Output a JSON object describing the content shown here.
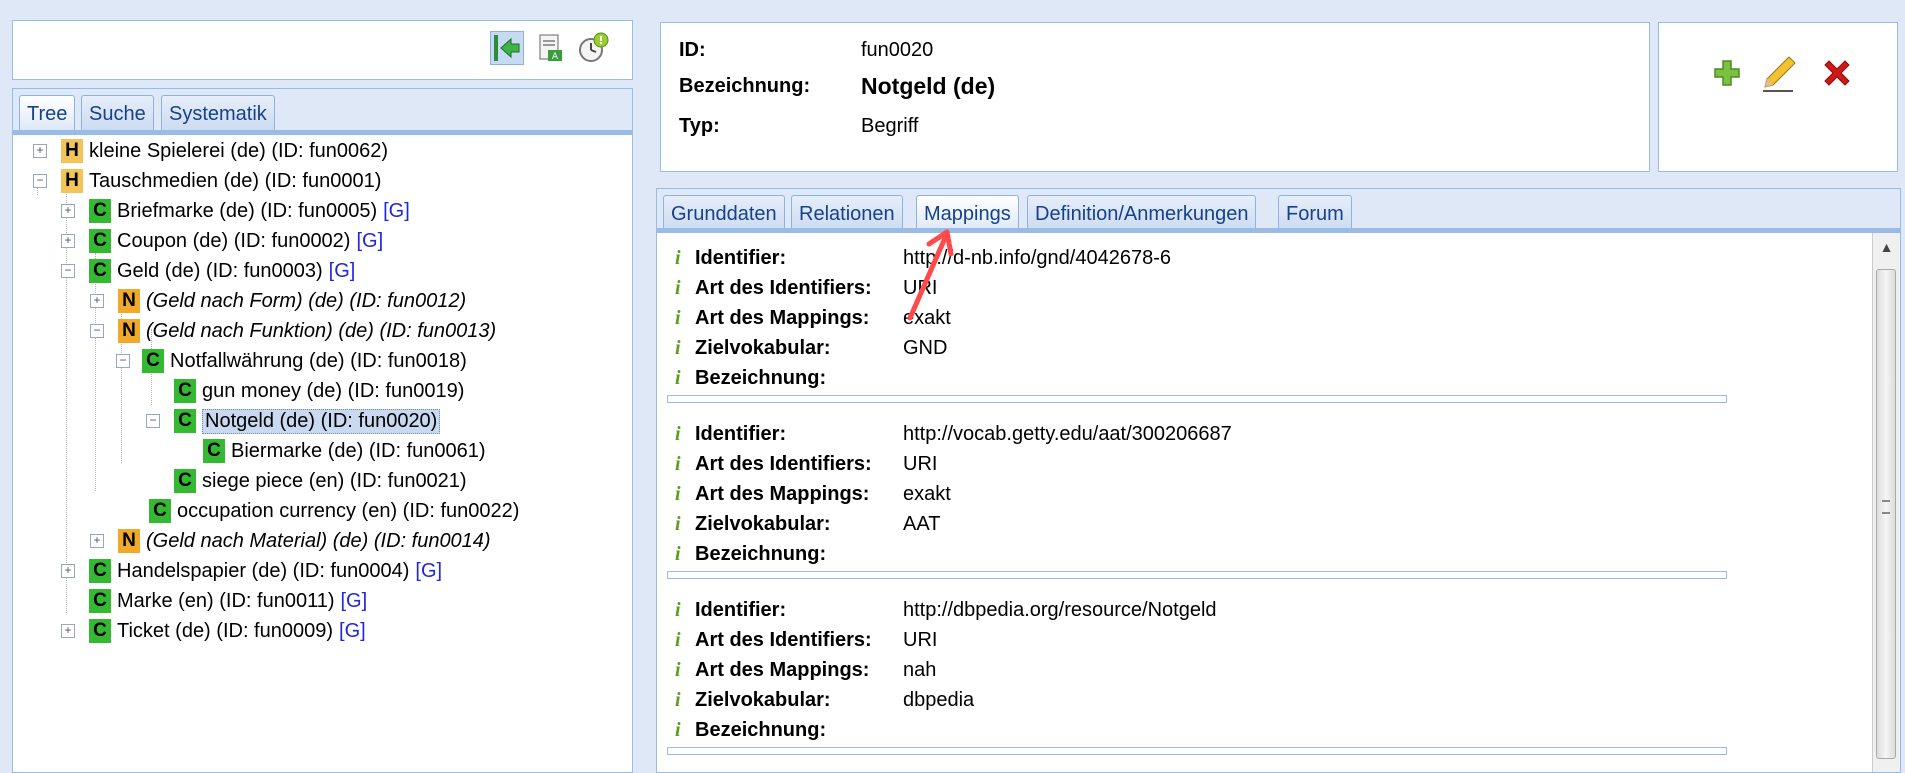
{
  "left_tabs": [
    "Tree",
    "Suche",
    "Systematik"
  ],
  "tree": [
    {
      "badge": "H",
      "label": "kleine Spielerei (de) (ID: fun0062)",
      "italic": false,
      "g": ""
    },
    {
      "badge": "H",
      "label": "Tauschmedien (de) (ID: fun0001)",
      "italic": false,
      "g": ""
    },
    {
      "badge": "C",
      "label": "Briefmarke (de) (ID: fun0005)",
      "italic": false,
      "g": "[G]"
    },
    {
      "badge": "C",
      "label": "Coupon (de) (ID: fun0002)",
      "italic": false,
      "g": "[G]"
    },
    {
      "badge": "C",
      "label": "Geld (de) (ID: fun0003)",
      "italic": false,
      "g": "[G]"
    },
    {
      "badge": "N",
      "label": "(Geld nach Form) (de) (ID: fun0012)",
      "italic": true,
      "g": ""
    },
    {
      "badge": "N",
      "label": "(Geld nach Funktion) (de) (ID: fun0013)",
      "italic": true,
      "g": ""
    },
    {
      "badge": "C",
      "label": "Notfallwährung (de) (ID: fun0018)",
      "italic": false,
      "g": ""
    },
    {
      "badge": "C",
      "label": "gun money (de) (ID: fun0019)",
      "italic": false,
      "g": ""
    },
    {
      "badge": "C",
      "label": "Notgeld (de) (ID: fun0020)",
      "italic": false,
      "g": ""
    },
    {
      "badge": "C",
      "label": "Biermarke (de) (ID: fun0061)",
      "italic": false,
      "g": ""
    },
    {
      "badge": "C",
      "label": "siege piece (en) (ID: fun0021)",
      "italic": false,
      "g": ""
    },
    {
      "badge": "C",
      "label": "occupation currency (en) (ID: fun0022)",
      "italic": false,
      "g": ""
    },
    {
      "badge": "N",
      "label": "(Geld nach Material) (de) (ID: fun0014)",
      "italic": true,
      "g": ""
    },
    {
      "badge": "C",
      "label": "Handelspapier (de) (ID: fun0004)",
      "italic": false,
      "g": "[G]"
    },
    {
      "badge": "C",
      "label": "Marke (en) (ID: fun0011)",
      "italic": false,
      "g": "[G]"
    },
    {
      "badge": "C",
      "label": "Ticket (de) (ID: fun0009)",
      "italic": false,
      "g": "[G]"
    }
  ],
  "detail": {
    "id_label": "ID:",
    "id_value": "fun0020",
    "name_label": "Bezeichnung:",
    "name_value": "Notgeld (de)",
    "type_label": "Typ:",
    "type_value": "Begriff"
  },
  "right_tabs": [
    "Grunddaten",
    "Relationen",
    "Mappings",
    "Definition/Anmerkungen",
    "Forum"
  ],
  "mapping_keys": {
    "identifier": "Identifier:",
    "id_type": "Art des Identifiers:",
    "mapping_type": "Art des Mappings:",
    "vocab": "Zielvokabular:",
    "name": "Bezeichnung:"
  },
  "info_glyph": "i",
  "mappings": [
    {
      "identifier": "http://d-nb.info/gnd/4042678-6",
      "id_type": "URI",
      "mapping_type": "exakt",
      "vocab": "GND",
      "name": ""
    },
    {
      "identifier": "http://vocab.getty.edu/aat/300206687",
      "id_type": "URI",
      "mapping_type": "exakt",
      "vocab": "AAT",
      "name": ""
    },
    {
      "identifier": "http://dbpedia.org/resource/Notgeld",
      "id_type": "URI",
      "mapping_type": "nah",
      "vocab": "dbpedia",
      "name": ""
    }
  ],
  "colors": {
    "accent": "#99bbe8",
    "tab_text": "#15428b",
    "badge_c": "#35b832",
    "badge_h": "#f3c45a",
    "badge_n": "#f0a92a",
    "link": "#2227d9",
    "annotation": "#ff4a4a"
  }
}
